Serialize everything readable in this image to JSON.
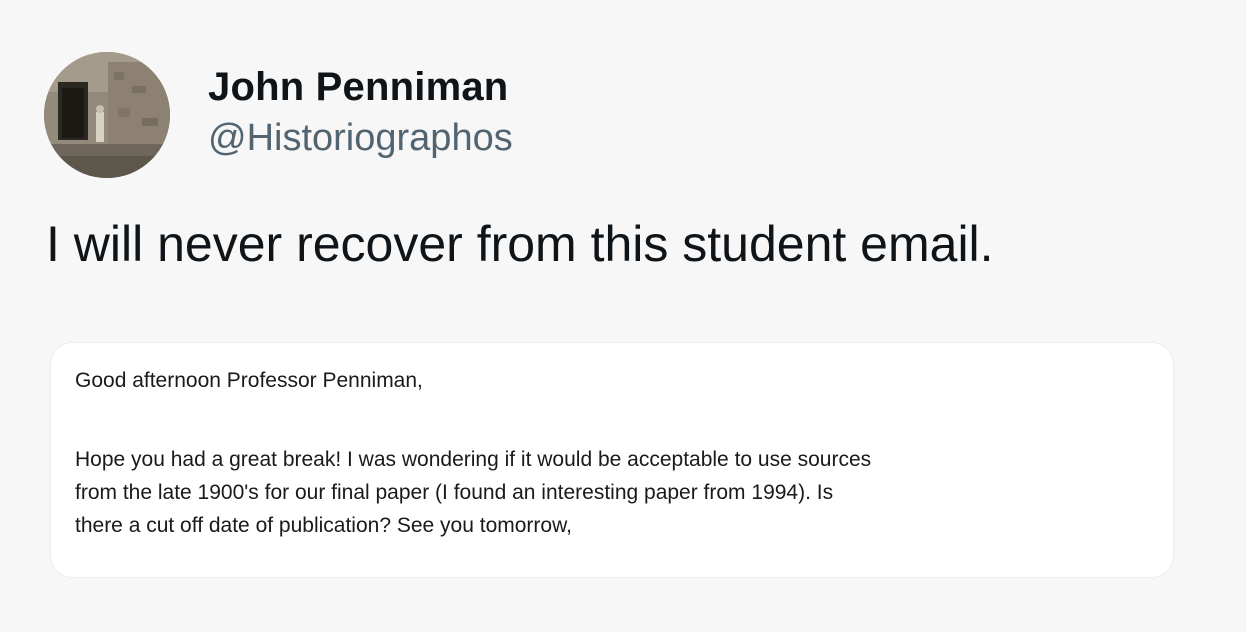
{
  "tweet": {
    "author": {
      "display_name": "John Penniman",
      "handle": "@Historiographos",
      "avatar_icon": "profile-photo-icon"
    },
    "text": "I will never recover from this student email.",
    "email": {
      "greeting": "Good afternoon Professor Penniman,",
      "body_lines": [
        "Hope you had a great break! I was wondering if it would be acceptable to use sources",
        "from the late 1900's for our final paper (I found an interesting paper from 1994). Is",
        "there a cut off date of publication? See you tomorrow,"
      ]
    }
  },
  "colors": {
    "background": "#f7f7f7",
    "text_primary": "#0f1419",
    "text_secondary": "#536471",
    "card_background": "#ffffff",
    "card_border": "#ececec"
  }
}
